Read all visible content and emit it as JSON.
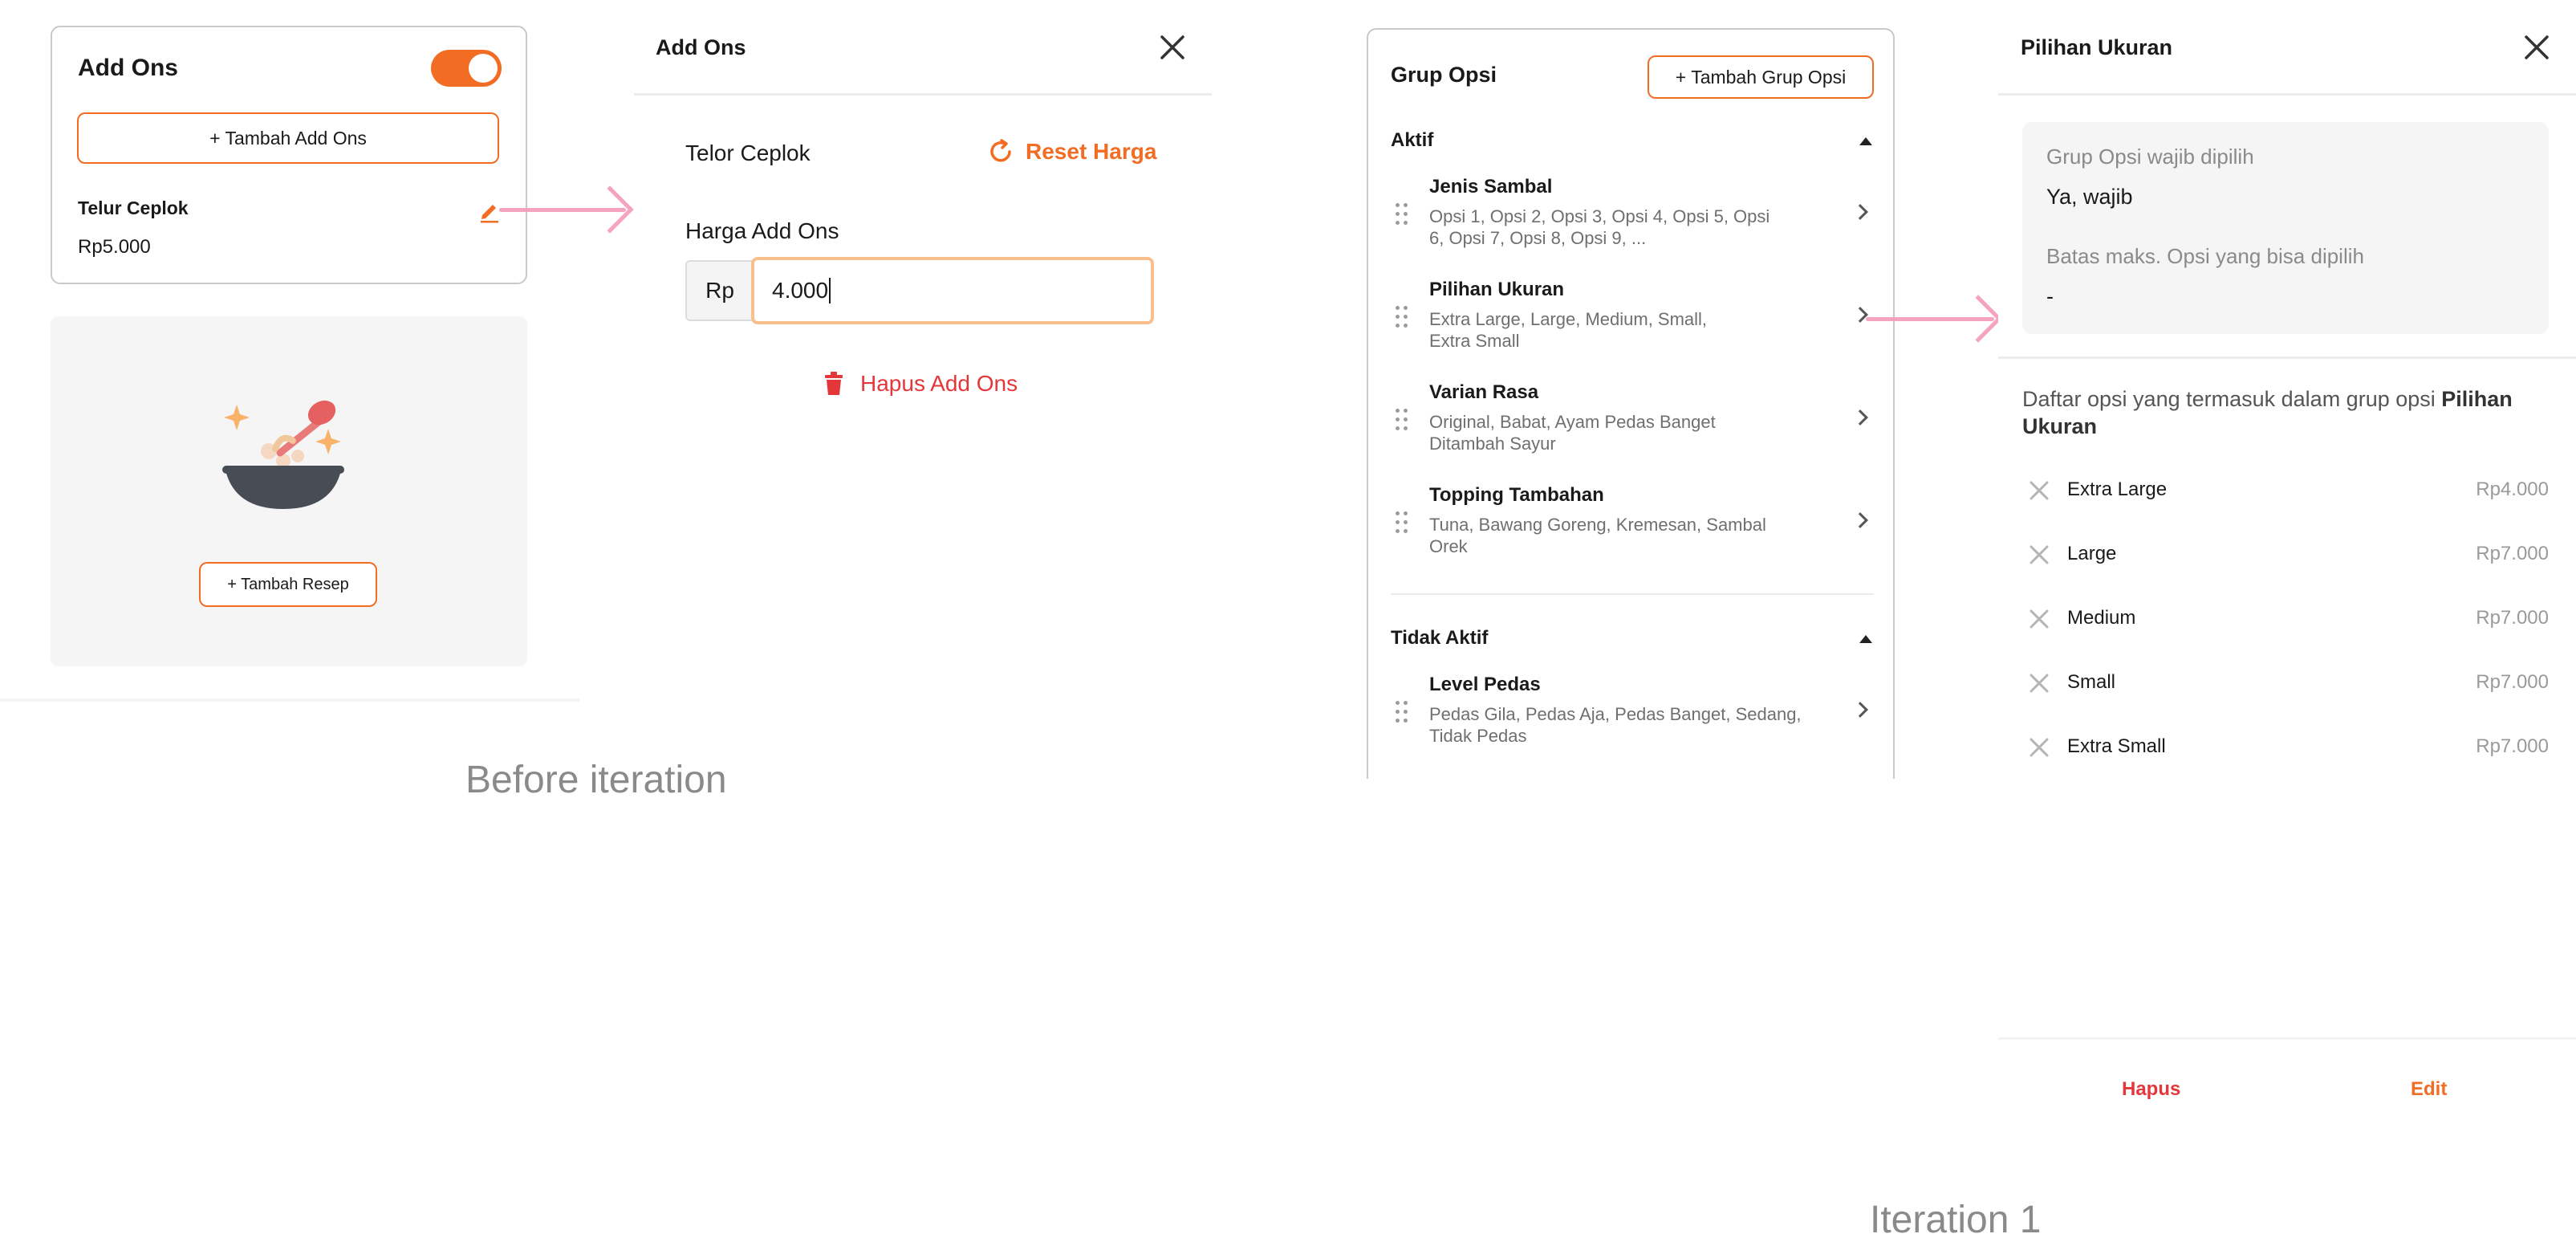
{
  "colors": {
    "accent": "#f26c24",
    "danger": "#e5363a",
    "arrow": "#f4a3c0",
    "muted": "#6f6f6f"
  },
  "card1": {
    "title": "Add Ons",
    "toggle_on": true,
    "add_button": "+ Tambah Add Ons",
    "item_name": "Telur Ceplok",
    "item_price": "Rp5.000",
    "edit_icon": "pencil-icon"
  },
  "recipe": {
    "illustration": "food-bowl-illustration",
    "button": "+ Tambah Resep"
  },
  "addons_panel": {
    "title": "Add Ons",
    "close_icon": "close-icon",
    "item_name": "Telor Ceplok",
    "reset_label": "Reset Harga",
    "price_label": "Harga Add Ons",
    "currency": "Rp",
    "price_value": "4.000",
    "delete_label": "Hapus Add Ons"
  },
  "caption_before": "Before iteration",
  "grup_opsi": {
    "title": "Grup Opsi",
    "add_button": "+ Tambah Grup Opsi",
    "active_label": "Aktif",
    "inactive_label": "Tidak Aktif",
    "active_items": [
      {
        "name": "Jenis Sambal",
        "desc1": "Opsi 1, Opsi 2, Opsi 3, Opsi 4, Opsi 5, Opsi",
        "desc2": "6, Opsi 7, Opsi 8, Opsi 9, ..."
      },
      {
        "name": "Pilihan Ukuran",
        "desc1": "Extra Large, Large, Medium, Small,",
        "desc2": "Extra Small"
      },
      {
        "name": "Varian Rasa",
        "desc1": "Original, Babat, Ayam Pedas Banget",
        "desc2": "Ditambah Sayur"
      },
      {
        "name": "Topping Tambahan",
        "desc1": "Tuna, Bawang Goreng, Kremesan, Sambal",
        "desc2": "Orek"
      }
    ],
    "inactive_items": [
      {
        "name": "Level Pedas",
        "desc1": "Pedas Gila, Pedas Aja, Pedas Banget, Sedang,",
        "desc2": "Tidak Pedas"
      }
    ]
  },
  "pilihan_panel": {
    "title": "Pilihan Ukuran",
    "close_icon": "close-icon",
    "required_label": "Grup Opsi wajib dipilih",
    "required_value": "Ya, wajib",
    "max_label": "Batas maks. Opsi yang bisa dipilih",
    "max_value": "-",
    "list_prefix": "Daftar opsi yang termasuk dalam grup opsi ",
    "list_group1": "Pilihan",
    "list_group2": "Ukuran",
    "options": [
      {
        "name": "Extra Large",
        "price": "Rp4.000"
      },
      {
        "name": "Large",
        "price": "Rp7.000"
      },
      {
        "name": "Medium",
        "price": "Rp7.000"
      },
      {
        "name": "Small",
        "price": "Rp7.000"
      },
      {
        "name": "Extra Small",
        "price": "Rp7.000"
      }
    ],
    "delete_label": "Hapus",
    "edit_label": "Edit"
  },
  "caption_iteration": "Iteration 1"
}
